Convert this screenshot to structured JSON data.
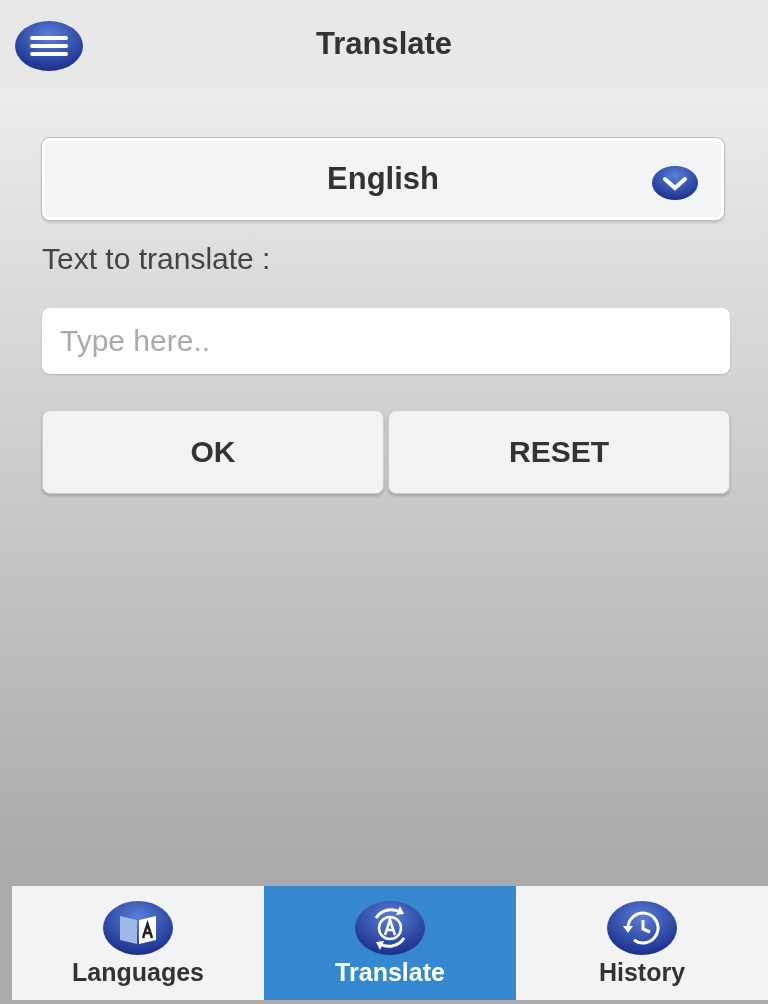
{
  "header": {
    "title": "Translate"
  },
  "language_select": {
    "value": "English"
  },
  "input_label": "Text to translate :",
  "text_field": {
    "placeholder": "Type here.."
  },
  "buttons": [
    "OK",
    "RESET"
  ],
  "tabs": [
    {
      "label": "Languages",
      "kind": "book",
      "selected": false
    },
    {
      "label": "Translate",
      "kind": "rotate",
      "selected": true
    },
    {
      "label": "History",
      "kind": "clock",
      "selected": false
    }
  ]
}
